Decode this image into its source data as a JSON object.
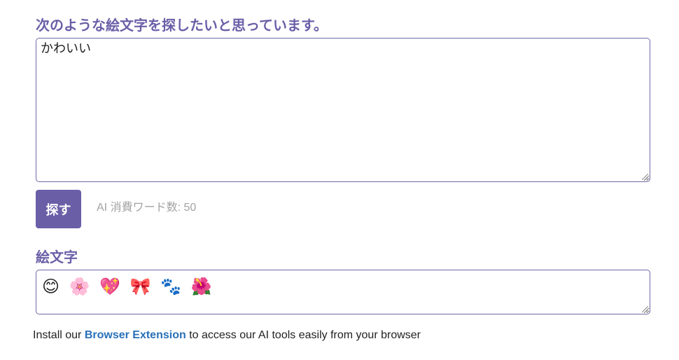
{
  "query": {
    "label": "次のような絵文字を探したいと思っています。",
    "value": "かわいい"
  },
  "search": {
    "button_label": "探す",
    "word_count_text": "AI 消費ワード数: 50"
  },
  "result": {
    "label": "絵文字",
    "emojis": [
      "😊",
      "🌸",
      "💖",
      "🎀",
      "🐾",
      "🌺"
    ]
  },
  "footer": {
    "prefix": "Install our ",
    "link_text": "Browser Extension",
    "suffix": " to access our AI tools easily from your browser"
  },
  "colors": {
    "accent": "#6a5fa7",
    "link": "#2a70b8",
    "muted": "#a3a3a3"
  }
}
